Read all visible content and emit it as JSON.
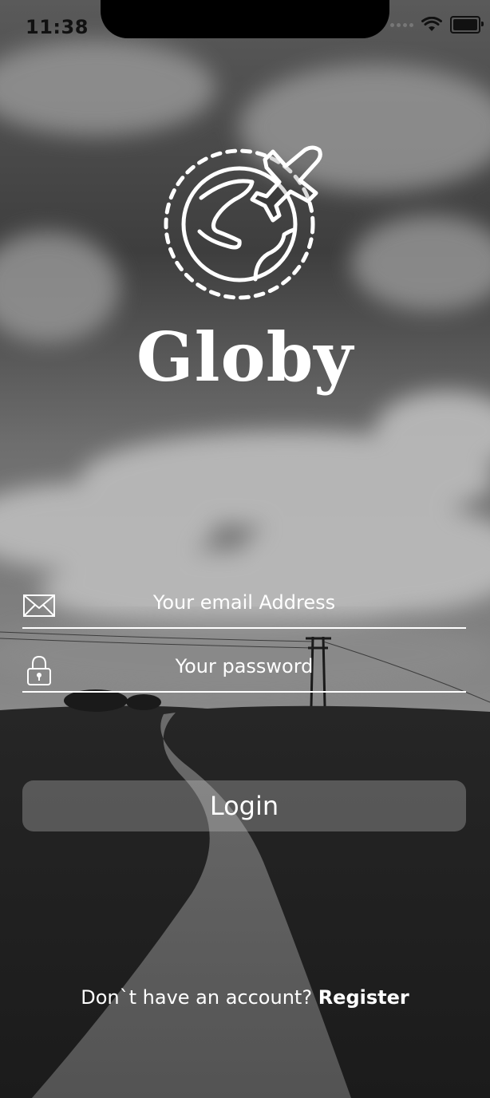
{
  "status_bar": {
    "time": "11:38",
    "icons": [
      "cellular-signal-icon",
      "wifi-icon",
      "battery-icon"
    ],
    "battery_level": 1.0
  },
  "app": {
    "name": "Globy",
    "logo_icon": "globe-airplane-icon"
  },
  "form": {
    "email": {
      "icon": "envelope-icon",
      "placeholder": "Your email Address",
      "value": ""
    },
    "password": {
      "icon": "padlock-icon",
      "placeholder": "Your password",
      "value": ""
    },
    "login_label": "Login"
  },
  "footer": {
    "prompt": "Don`t have an account?",
    "register_label": "Register"
  },
  "colors": {
    "text": "#ffffff",
    "button_bg": "rgba(200,200,200,0.32)",
    "underline": "#ffffff"
  }
}
